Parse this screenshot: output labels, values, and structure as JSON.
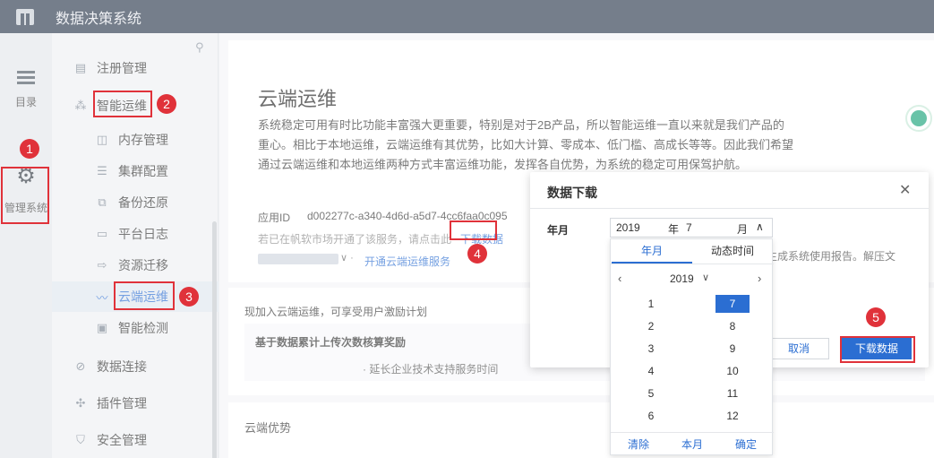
{
  "app": {
    "title": "数据决策系统"
  },
  "rail": {
    "directory_label": "目录",
    "management_label": "管理系统"
  },
  "sidebar": {
    "items": [
      {
        "label": "注册管理",
        "icon": "register-icon"
      },
      {
        "label": "智能运维",
        "icon": "ops-icon"
      },
      {
        "label": "内存管理",
        "icon": "memory-icon"
      },
      {
        "label": "集群配置",
        "icon": "cluster-icon"
      },
      {
        "label": "备份还原",
        "icon": "backup-icon"
      },
      {
        "label": "平台日志",
        "icon": "log-icon"
      },
      {
        "label": "资源迁移",
        "icon": "migrate-icon"
      },
      {
        "label": "云端运维",
        "icon": "cloud-ops-icon"
      },
      {
        "label": "智能检测",
        "icon": "detect-icon"
      },
      {
        "label": "数据连接",
        "icon": "link-icon"
      },
      {
        "label": "插件管理",
        "icon": "plugin-icon"
      },
      {
        "label": "安全管理",
        "icon": "shield-icon"
      }
    ]
  },
  "main": {
    "heading": "云端运维",
    "paragraph": "系统稳定可用有时比功能丰富强大更重要，特别是对于2B产品，所以智能运维一直以来就是我们产品的重心。相比于本地运维，云端运维有其优势，比如大计算、零成本、低门槛、高成长等等。因此我们希望通过云端运维和本地运维两种方式丰富运维功能，发挥各自优势，为系统的稳定可用保驾护航。",
    "app_id_label": "应用ID",
    "app_id_value": "d002277c-a340-4d6d-a5d7-4cc6faa0c095",
    "hint_text": "若已在帆软市场开通了该服务，请点击此",
    "download_link": "下载数据",
    "open_service": "开通云端运维服务",
    "incentive_title": "现加入云端运维，可享受用户激励计划",
    "incentive_sub": "基于数据累计上传次数核算奖励",
    "incentive_item": "· 延长企业技术支持服务时间",
    "advantage_title": "云端优势"
  },
  "dialog": {
    "title": "数据下载",
    "field_label": "年月",
    "hint": "与生成系统使用报告。解压文",
    "cancel": "取消",
    "confirm": "下载数据"
  },
  "datepicker": {
    "year": "2019",
    "year_unit": "年",
    "month": "7",
    "month_unit": "月",
    "tab_month": "年月",
    "tab_dynamic": "动态时间",
    "nav_year": "2019",
    "months": [
      "1",
      "2",
      "3",
      "4",
      "5",
      "6",
      "7",
      "8",
      "9",
      "10",
      "11",
      "12"
    ],
    "selected_month": "7",
    "clear": "清除",
    "this_month": "本月",
    "ok": "确定"
  },
  "annotations": [
    "1",
    "2",
    "3",
    "4",
    "5"
  ],
  "colors": {
    "accent": "#2b6ed2",
    "annotation": "#e0323a",
    "topbar": "#2c3a4d"
  }
}
